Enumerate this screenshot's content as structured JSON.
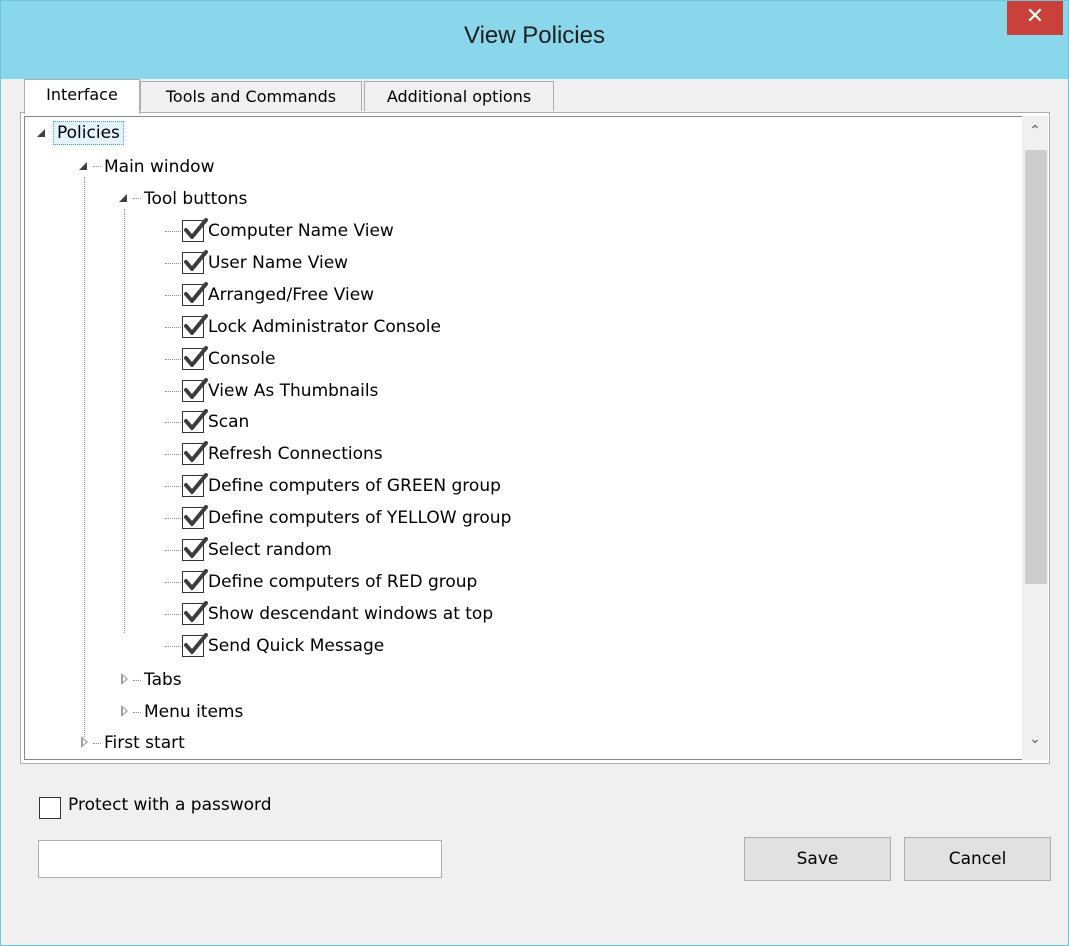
{
  "window": {
    "title": "View Policies",
    "close_glyph": "✕"
  },
  "tabs": [
    {
      "label": "Interface",
      "active": true
    },
    {
      "label": "Tools and Commands",
      "active": false
    },
    {
      "label": "Additional options",
      "active": false
    }
  ],
  "tree": {
    "root": {
      "label": "Policies",
      "expanded": true,
      "selected": true
    },
    "main_window": {
      "label": "Main window",
      "expanded": true
    },
    "tool_buttons": {
      "label": "Tool buttons",
      "expanded": true
    },
    "items": [
      {
        "label": "Computer Name View",
        "checked": true
      },
      {
        "label": "User Name View",
        "checked": true
      },
      {
        "label": "Arranged/Free View",
        "checked": true
      },
      {
        "label": "Lock Administrator Console",
        "checked": true
      },
      {
        "label": "Console",
        "checked": true
      },
      {
        "label": "View As Thumbnails",
        "checked": true
      },
      {
        "label": "Scan",
        "checked": true
      },
      {
        "label": "Refresh Connections",
        "checked": true
      },
      {
        "label": "Define computers of GREEN group",
        "checked": true
      },
      {
        "label": "Define computers of YELLOW group",
        "checked": true
      },
      {
        "label": "Select random",
        "checked": true
      },
      {
        "label": "Define computers of RED group",
        "checked": true
      },
      {
        "label": "Show descendant windows at top",
        "checked": true
      },
      {
        "label": "Send Quick Message",
        "checked": true
      }
    ],
    "tabs_node": {
      "label": "Tabs",
      "expanded": false
    },
    "menu_items_node": {
      "label": "Menu items",
      "expanded": false
    },
    "first_start_node": {
      "label": "First start",
      "expanded": false
    }
  },
  "scrollbar": {
    "up_glyph": "⌃",
    "down_glyph": "⌄"
  },
  "password": {
    "checkbox_label": "Protect with a password",
    "checked": false,
    "value": ""
  },
  "buttons": {
    "save": "Save",
    "cancel": "Cancel"
  },
  "colors": {
    "titlebar": "#8ad6ea",
    "close": "#c9413a",
    "window_bg": "#f0f0f0"
  }
}
